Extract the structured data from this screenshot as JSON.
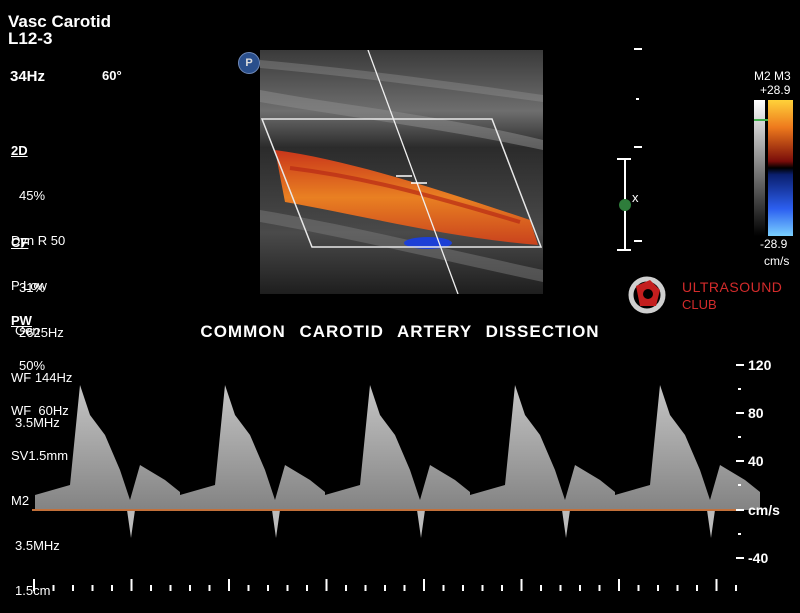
{
  "header": {
    "preset": "Vasc Carotid",
    "probe": "L12-3",
    "frame_rate": "34Hz",
    "angle": "60°"
  },
  "params": {
    "twod_label": "2D",
    "twod": [
      "45%",
      "Dyn R 50",
      "P Low",
      "Gen"
    ],
    "cf_label": "CF",
    "cf": [
      "31%",
      "2625Hz",
      "WF 144Hz",
      "3.5MHz"
    ],
    "pw_label": "PW",
    "pw": [
      "50%",
      "WF  60Hz",
      "SV1.5mm",
      "M2",
      "3.5MHz",
      "1.5cm"
    ]
  },
  "probe_badge": "P",
  "color_bar": {
    "label": "M2 M3",
    "top": "+28.9",
    "bottom": "-28.9",
    "unit": "cm/s"
  },
  "depth_marker": "x",
  "logo": {
    "line1": "ULTRASOUND",
    "line2": "CLUB"
  },
  "title": "COMMON  CAROTID  ARTERY  DISSECTION",
  "doppler_scale": {
    "labels": [
      "120",
      "80",
      "40",
      "cm/s",
      "-40"
    ],
    "unit": "cm/s"
  },
  "colors": {
    "flow_red": "#d9471a",
    "flow_orange": "#e77b1f",
    "flow_blue": "#1c3fd6",
    "baseline": "#c2703a",
    "brand_red": "#d32b2b"
  }
}
